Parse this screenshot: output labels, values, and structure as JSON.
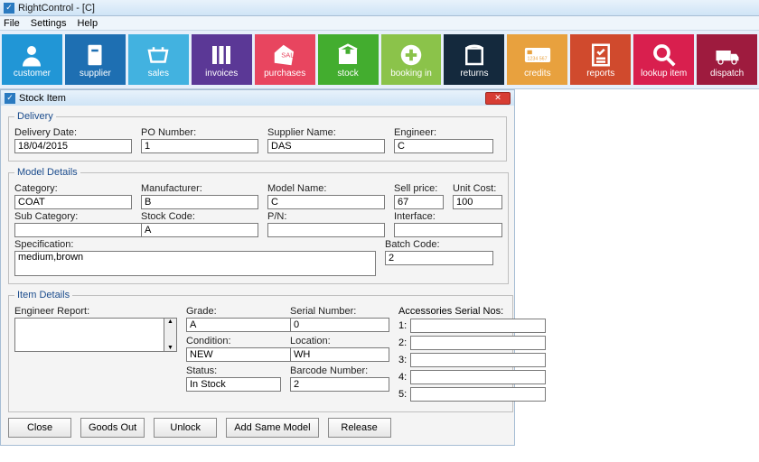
{
  "window": {
    "title": "RightControl - [C]"
  },
  "menu": {
    "file": "File",
    "settings": "Settings",
    "help": "Help"
  },
  "toolbar": {
    "customer": "customer",
    "supplier": "supplier",
    "sales": "sales",
    "invoices": "invoices",
    "purchases": "purchases",
    "stock": "stock",
    "booking": "booking in",
    "returns": "returns",
    "credits": "credits",
    "reports": "reports",
    "lookup": "lookup item",
    "dispatch": "dispatch",
    "credits_digits": "1234 567"
  },
  "mdi": {
    "title": "Stock Item"
  },
  "delivery": {
    "legend": "Delivery",
    "date_label": "Delivery Date:",
    "date": "18/04/2015",
    "po_label": "PO Number:",
    "po": "1",
    "supplier_label": "Supplier Name:",
    "supplier": "DAS",
    "engineer_label": "Engineer:",
    "engineer": "C"
  },
  "model": {
    "legend": "Model Details",
    "category_label": "Category:",
    "category": "COAT",
    "manufacturer_label": "Manufacturer:",
    "manufacturer": "B",
    "modelname_label": "Model Name:",
    "modelname": "C",
    "sell_label": "Sell price:",
    "sell": "67",
    "unitcost_label": "Unit Cost:",
    "unitcost": "100",
    "subcat_label": "Sub Category:",
    "subcat": "",
    "stockcode_label": "Stock Code:",
    "stockcode": "A",
    "pn_label": "P/N:",
    "pn": "",
    "interface_label": "Interface:",
    "interface": "",
    "spec_label": "Specification:",
    "spec": "medium,brown",
    "batch_label": "Batch Code:",
    "batch": "2"
  },
  "item": {
    "legend": "Item Details",
    "engreport_label": "Engineer Report:",
    "engreport": "",
    "grade_label": "Grade:",
    "grade": "A",
    "condition_label": "Condition:",
    "condition": "NEW",
    "status_label": "Status:",
    "status": "In Stock",
    "serial_label": "Serial Number:",
    "serial": "0",
    "location_label": "Location:",
    "location": "WH",
    "barcode_label": "Barcode Number:",
    "barcode": "2",
    "acc_label": "Accessories Serial Nos:",
    "acc": {
      "n1": "1:",
      "n2": "2:",
      "n3": "3:",
      "n4": "4:",
      "n5": "5:",
      "v1": "",
      "v2": "",
      "v3": "",
      "v4": "",
      "v5": ""
    }
  },
  "buttons": {
    "close": "Close",
    "goodsout": "Goods Out",
    "unlock": "Unlock",
    "addsame": "Add Same Model",
    "release": "Release"
  }
}
